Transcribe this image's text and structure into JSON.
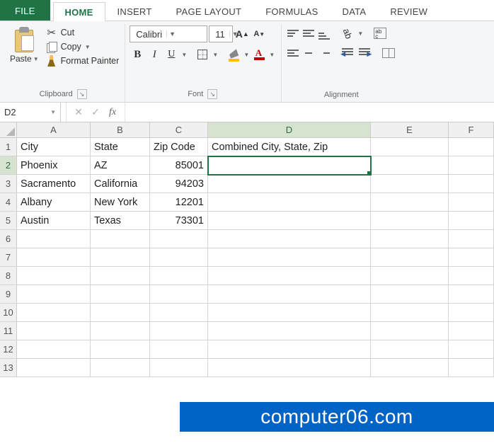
{
  "tabs": {
    "file": "FILE",
    "home": "HOME",
    "insert": "INSERT",
    "page_layout": "PAGE LAYOUT",
    "formulas": "FORMULAS",
    "data": "DATA",
    "review": "REVIEW"
  },
  "ribbon": {
    "clipboard": {
      "label": "Clipboard",
      "paste": "Paste",
      "cut": "Cut",
      "copy": "Copy",
      "format_painter": "Format Painter"
    },
    "font": {
      "label": "Font",
      "name": "Calibri",
      "size": "11"
    },
    "alignment": {
      "label": "Alignment"
    }
  },
  "formula_bar": {
    "name_box": "D2",
    "formula": ""
  },
  "grid": {
    "columns": [
      "A",
      "B",
      "C",
      "D",
      "E",
      "F"
    ],
    "rows": [
      "1",
      "2",
      "3",
      "4",
      "5",
      "6",
      "7",
      "8",
      "9",
      "10",
      "11",
      "12",
      "13"
    ],
    "active": "D2",
    "data": {
      "r1": {
        "A": "City",
        "B": "State",
        "C": "Zip Code",
        "D": "Combined City, State, Zip"
      },
      "r2": {
        "A": "Phoenix",
        "B": "AZ",
        "C": "85001"
      },
      "r3": {
        "A": "Sacramento",
        "B": "California",
        "C": "94203"
      },
      "r4": {
        "A": "Albany",
        "B": "New York",
        "C": "12201"
      },
      "r5": {
        "A": "Austin",
        "B": "Texas",
        "C": "73301"
      }
    }
  },
  "watermark": "computer06.com"
}
